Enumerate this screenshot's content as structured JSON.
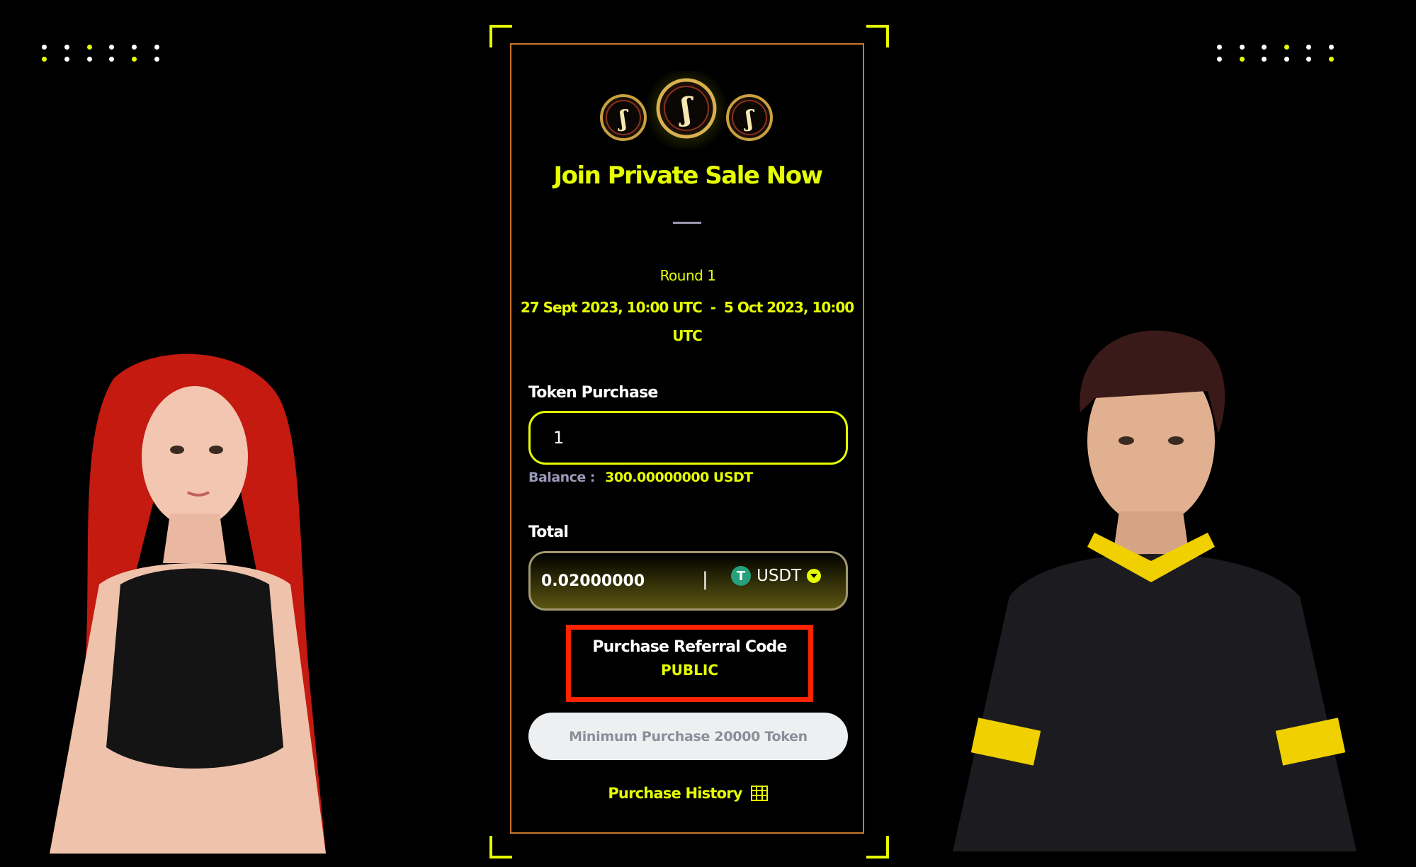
{
  "colors": {
    "accent": "#e6ff00",
    "card_border": "#c8782a",
    "highlight": "#ff2200"
  },
  "sale": {
    "title": "Join Private Sale Now",
    "round": "Round 1",
    "dates_line1": "27 Sept 2023, 10:00 UTC  -  5 Oct 2023, 10:00",
    "dates_line2": "UTC"
  },
  "token_purchase": {
    "label": "Token Purchase",
    "value": "1"
  },
  "balance": {
    "label": "Balance :",
    "value": "300.00000000 USDT"
  },
  "total": {
    "label": "Total",
    "value": "0.02000000",
    "separator": "|",
    "currency": "USDT",
    "currency_icon": "tether-icon"
  },
  "referral": {
    "label": "Purchase Referral Code",
    "value": "PUBLIC"
  },
  "min_button": {
    "label": "Minimum Purchase 20000 Token"
  },
  "history": {
    "label": "Purchase History",
    "icon": "table-icon"
  }
}
